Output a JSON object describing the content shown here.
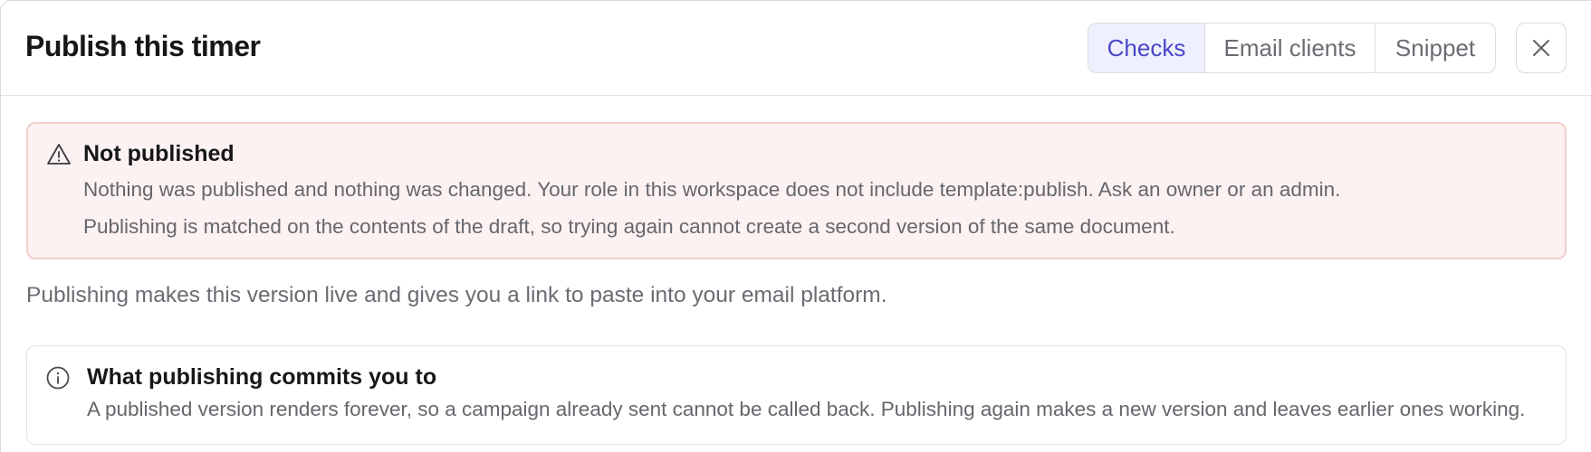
{
  "dialog": {
    "title": "Publish this timer",
    "close_icon": "close-icon"
  },
  "tabs": [
    {
      "label": "Checks",
      "active": true
    },
    {
      "label": "Email clients",
      "active": false
    },
    {
      "label": "Snippet",
      "active": false
    }
  ],
  "alert": {
    "icon": "warning-triangle-icon",
    "title": "Not published",
    "line1": "Nothing was published and nothing was changed. Your role in this workspace does not include template:publish. Ask an owner or an admin.",
    "line2": "Publishing is matched on the contents of the draft, so trying again cannot create a second version of the same document."
  },
  "intro": "Publishing makes this version live and gives you a link to paste into your email platform.",
  "info": {
    "icon": "info-circle-icon",
    "title": "What publishing commits you to",
    "text": "A published version renders forever, so a campaign already sent cannot be called back. Publishing again makes a new version and leaves earlier ones working."
  },
  "colors": {
    "accent": "#4a47c9",
    "accent_bg": "#eef0fd",
    "alert_bg": "#fcf2f1",
    "alert_border": "#f0cfca"
  }
}
